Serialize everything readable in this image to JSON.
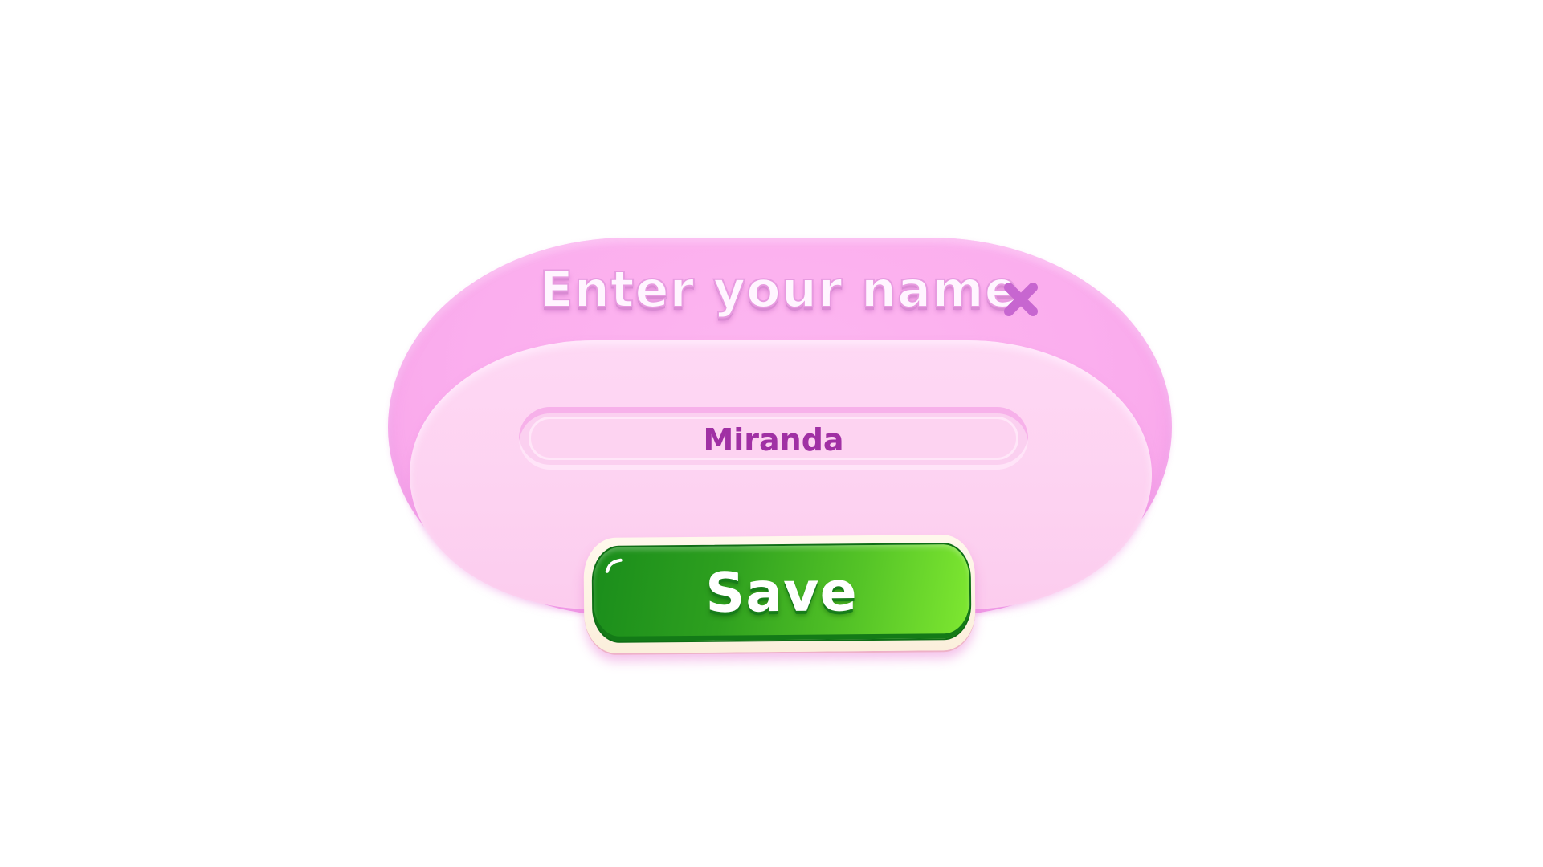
{
  "dialog": {
    "title": "Enter your name",
    "close_icon": "close-icon",
    "name_value": "Miranda",
    "save_label": "Save"
  },
  "colors": {
    "panel": "#fbaeee",
    "panel_inner": "#fdd2f1",
    "title_outline": "#e79be0",
    "close_icon": "#c766d0",
    "name_text": "#a030a4",
    "save_green_dark": "#1a8d1b",
    "save_green_light": "#7fe831"
  }
}
